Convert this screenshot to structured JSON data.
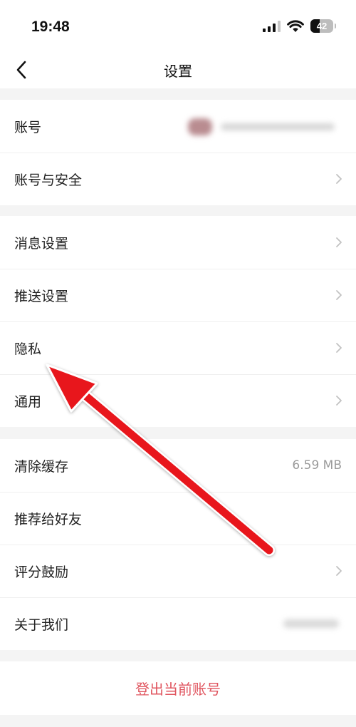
{
  "status_bar": {
    "time": "19:48",
    "battery": "42",
    "battery_level": 0.42,
    "icons": [
      "signal-icon",
      "wifi-icon",
      "battery-icon"
    ]
  },
  "header": {
    "title": "设置",
    "back_icon": "chevron-left-icon"
  },
  "groups": [
    {
      "rows": [
        {
          "label": "账号",
          "value_blurred": true
        },
        {
          "label": "账号与安全",
          "chevron": true
        }
      ]
    },
    {
      "rows": [
        {
          "label": "消息设置",
          "chevron": true
        },
        {
          "label": "推送设置",
          "chevron": true
        },
        {
          "label": "隐私",
          "chevron": true
        },
        {
          "label": "通用",
          "chevron": true
        }
      ]
    },
    {
      "rows": [
        {
          "label": "清除缓存",
          "value": "6.59 MB"
        },
        {
          "label": "推荐给好友"
        },
        {
          "label": "评分鼓励",
          "chevron": true
        },
        {
          "label": "关于我们",
          "value_blurred": true
        }
      ]
    }
  ],
  "logout_label": "登出当前账号",
  "colors": {
    "background": "#f4f4f4",
    "logout_text": "#e0555f",
    "annotation_arrow": "#e8141c"
  },
  "annotation": {
    "type": "arrow",
    "points_to": "隐私"
  }
}
